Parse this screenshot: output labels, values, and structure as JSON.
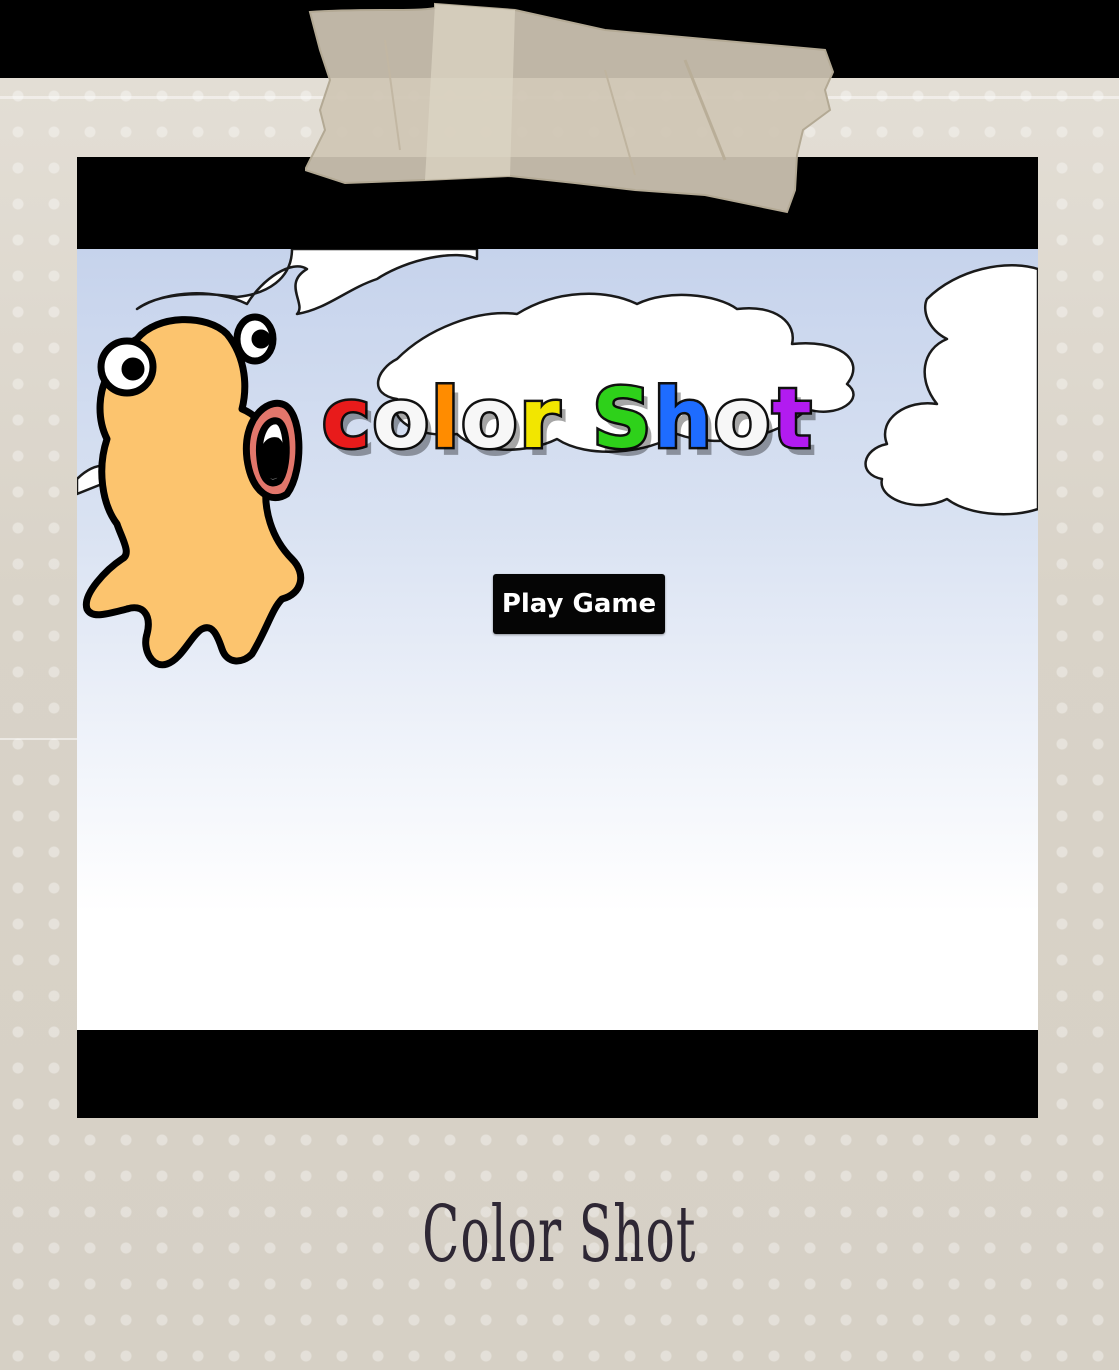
{
  "game": {
    "title_letters": [
      {
        "char": "c",
        "color": "#e81b1b"
      },
      {
        "char": "o",
        "color": "#f7f7f7"
      },
      {
        "char": "l",
        "color": "#ff8c00"
      },
      {
        "char": "o",
        "color": "#f7f7f7"
      },
      {
        "char": "r",
        "color": "#f2e600"
      },
      {
        "char": " ",
        "color": "#000000"
      },
      {
        "char": "S",
        "color": "#2ed11a"
      },
      {
        "char": "h",
        "color": "#1e6cff"
      },
      {
        "char": "o",
        "color": "#f7f7f7"
      },
      {
        "char": "t",
        "color": "#b21bf0"
      }
    ],
    "play_button_label": "Play Game"
  },
  "caption": "Color Shot",
  "colors": {
    "sky_top": "#c6d3ec",
    "monster_body": "#fcc46e",
    "monster_mouth": "#e2766b",
    "button_bg": "#050505",
    "caption_text": "#2e2734"
  },
  "icons": {
    "mascot": "orange-monster-icon",
    "tape": "masking-tape"
  }
}
